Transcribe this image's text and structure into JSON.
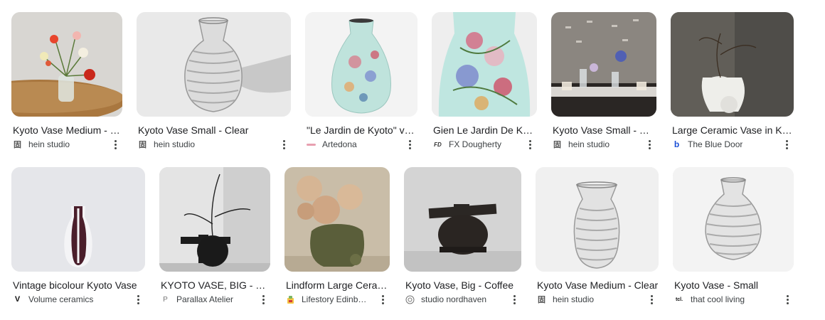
{
  "results": [
    {
      "title": "Kyoto Vase Medium - Clear",
      "source": "hein studio",
      "favicon": "hein-studio-icon"
    },
    {
      "title": "Kyoto Vase Small - Clear",
      "source": "hein studio",
      "favicon": "hein-studio-icon"
    },
    {
      "title": "\"Le Jardin de Kyoto\" vase",
      "source": "Artedona",
      "favicon": "artedona-icon"
    },
    {
      "title": "Gien Le Jardin De Kyoto Vase",
      "source": "FX Dougherty",
      "favicon": "fx-dougherty-icon"
    },
    {
      "title": "Kyoto Vase Small - Clear",
      "source": "hein studio",
      "favicon": "hein-studio-icon"
    },
    {
      "title": "Large Ceramic Vase in Kyoto White",
      "source": "The Blue Door",
      "favicon": "blue-door-icon"
    },
    {
      "title": "Vintage bicolour Kyoto Vase",
      "source": "Volume ceramics",
      "favicon": "volume-ceramics-icon"
    },
    {
      "title": "KYOTO VASE, BIG - Black",
      "source": "Parallax Atelier",
      "favicon": "parallax-atelier-icon"
    },
    {
      "title": "Lindform Large Ceramic Kyoto Vase",
      "source": "Lifestory Edinburgh",
      "favicon": "lifestory-icon"
    },
    {
      "title": "Kyoto Vase, Big - Coffee",
      "source": "studio nordhaven",
      "favicon": "studio-nordhaven-icon"
    },
    {
      "title": "Kyoto Vase Medium - Clear",
      "source": "hein studio",
      "favicon": "hein-studio-icon"
    },
    {
      "title": "Kyoto Vase - Small",
      "source": "that cool living",
      "favicon": "that-cool-living-icon"
    }
  ],
  "favicons": {
    "hein": "固",
    "fx": "FD",
    "blue": "b",
    "volume": "V",
    "parallax": "P",
    "cool": "tcl."
  },
  "colors": {
    "text": "#202124",
    "secondary": "#3c4043",
    "blue_door": "#1a4fd6",
    "artedona": "#e8a0b0"
  }
}
